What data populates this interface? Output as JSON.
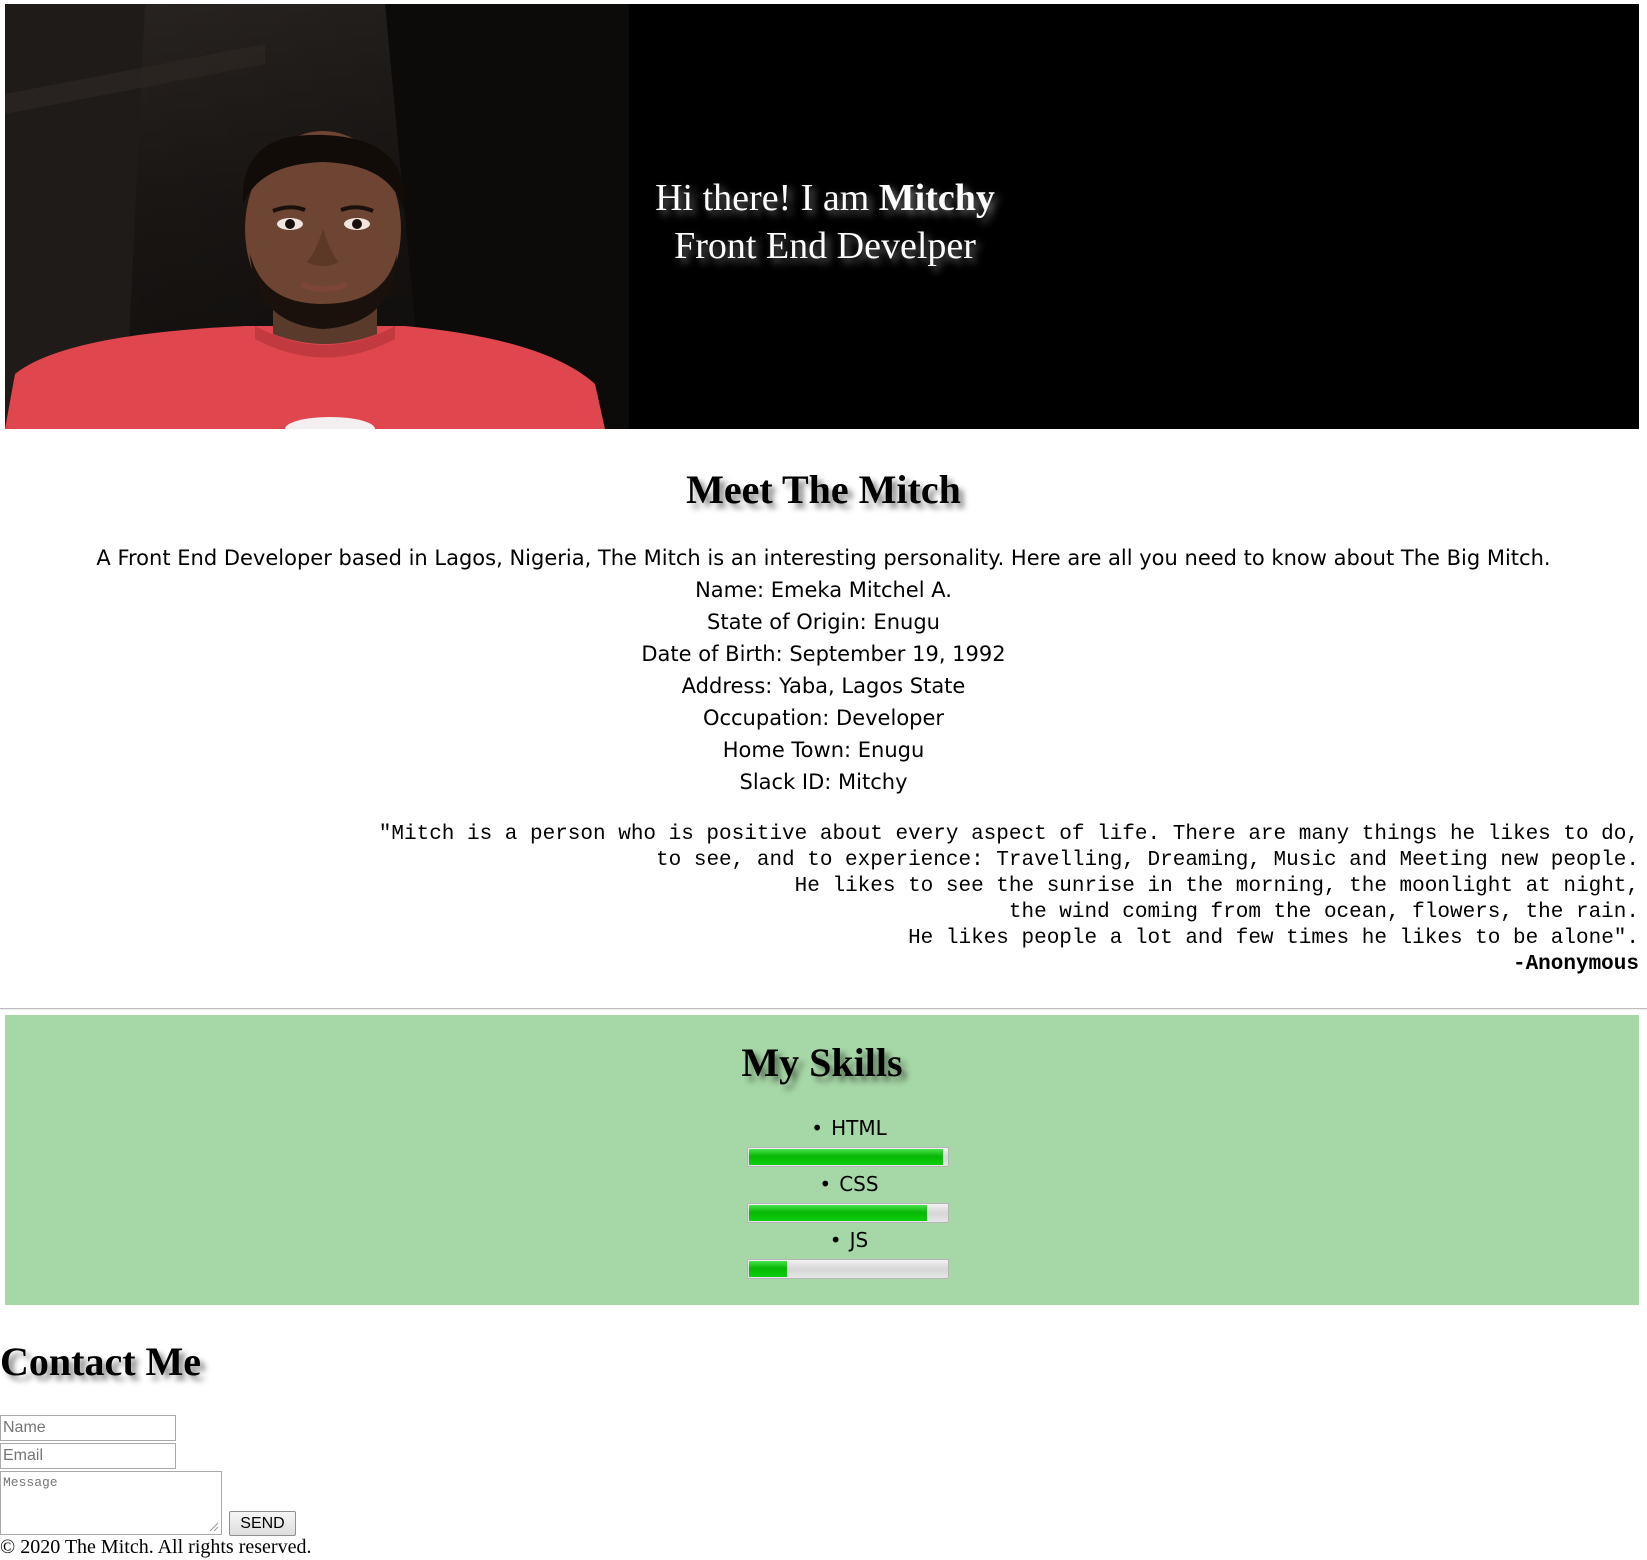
{
  "hero": {
    "greeting": "Hi there! I am",
    "name": "Mitchy",
    "role": "Front End Develper",
    "photo": "portrait-photo"
  },
  "about": {
    "title": "Meet The Mitch",
    "intro": "A Front End Developer based in Lagos, Nigeria, The Mitch is an interesting personality. Here are all you need to know about The Big Mitch.",
    "facts": [
      "Name: Emeka Mitchel A.",
      "State of Origin: Enugu",
      "Date of Birth: September 19, 1992",
      "Address: Yaba, Lagos State",
      "Occupation: Developer",
      "Home Town: Enugu",
      "Slack ID: Mitchy"
    ],
    "quote_lines": [
      "\"Mitch is a person who is positive about every aspect of life. There are many things he likes to do,",
      "to see, and to experience: Travelling, Dreaming, Music and Meeting new people.",
      "He likes to see the sunrise in the morning, the moonlight at night,",
      "the wind coming from the ocean, flowers, the rain.",
      "He likes people a lot and few times he likes to be alone\"."
    ],
    "quote_author": "-Anonymous"
  },
  "skills": {
    "title": "My Skills",
    "items": [
      {
        "label": "HTML",
        "level": 0.98
      },
      {
        "label": "CSS",
        "level": 0.9
      },
      {
        "label": "JS",
        "level": 0.2
      }
    ],
    "bar_color": "#06b806",
    "section_color": "#a6d7a6"
  },
  "contact": {
    "title": "Contact Me",
    "name_placeholder": "Name",
    "email_placeholder": "Email",
    "message_placeholder": "Message",
    "send_label": "SEND"
  },
  "footer": {
    "text": "© 2020 The Mitch. All rights reserved."
  }
}
